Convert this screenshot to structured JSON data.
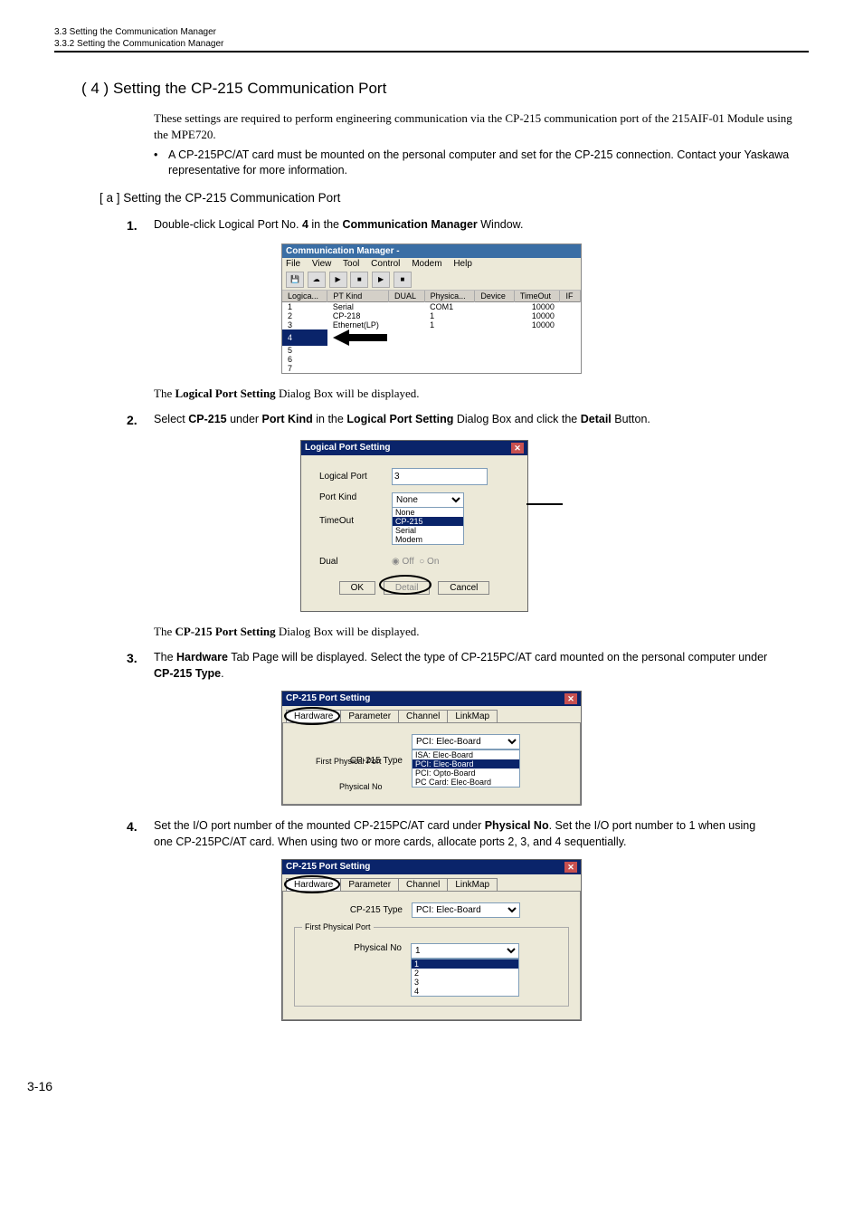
{
  "header": {
    "top": "3.3  Setting the Communication Manager",
    "sub": "3.3.2  Setting the Communication Manager"
  },
  "section4": {
    "title": "( 4 )   Setting the CP-215 Communication Port",
    "intro": "These settings are required to perform engineering communication via the CP-215 communication port of the 215AIF-01 Module using the MPE720.",
    "bullet": "A CP-215PC/AT card must be mounted on the personal computer and set for the CP-215 connection. Contact your Yaskawa representative for more information."
  },
  "suba": {
    "title": "[ a ]  Setting the CP-215 Communication Port"
  },
  "step1": {
    "num": "1.",
    "pre": "Double-click Logical Port No. ",
    "bold1": "4",
    "mid": " in the ",
    "bold2": "Communication Manager",
    "post": " Window."
  },
  "fig1": {
    "title": "Communication Manager -",
    "menu": {
      "file": "File",
      "view": "View",
      "tool": "Tool",
      "control": "Control",
      "modem": "Modem",
      "help": "Help"
    },
    "head": {
      "logical": "Logica...",
      "ptkind": "PT Kind",
      "dual": "DUAL",
      "physical": "Physica...",
      "device": "Device",
      "timeout": "TimeOut",
      "ir": "IF"
    },
    "rows": [
      {
        "n": "1",
        "kind": "Serial",
        "dual": "",
        "phy": "COM1",
        "dev": "",
        "to": "10000"
      },
      {
        "n": "2",
        "kind": "CP-218",
        "dual": "",
        "phy": "1",
        "dev": "",
        "to": "10000"
      },
      {
        "n": "3",
        "kind": "Ethernet(LP)",
        "dual": "",
        "phy": "1",
        "dev": "",
        "to": "10000"
      }
    ],
    "hl": "4",
    "extra": [
      "5",
      "6",
      "7"
    ]
  },
  "note1": {
    "pre": "The ",
    "b": "Logical Port Setting",
    "post": " Dialog Box will be displayed."
  },
  "step2": {
    "num": "2.",
    "t1": "Select ",
    "b1": "CP-215",
    "t2": " under ",
    "b2": "Port Kind",
    "t3": " in the ",
    "b3": "Logical Port Setting",
    "t4": " Dialog Box and click the ",
    "b4": "Detail",
    "t5": " Button."
  },
  "fig2": {
    "title": "Logical Port Setting",
    "logicalport_l": "Logical Port",
    "logicalport_v": "3",
    "portkind_l": "Port Kind",
    "portkind_v": "None",
    "list": [
      "None",
      "CP-215",
      "Serial",
      "Modem"
    ],
    "timeout_l": "TimeOut",
    "dual_l": "Dual",
    "dual_off": "Off",
    "dual_on": "On",
    "ok": "OK",
    "detail": "Detail",
    "cancel": "Cancel"
  },
  "note2": {
    "pre": "The ",
    "b": "CP-215 Port Setting",
    "post": " Dialog Box will be displayed."
  },
  "step3": {
    "num": "3.",
    "t1": "The ",
    "b1": "Hardware",
    "t2": " Tab Page will be displayed. Select the type of CP-215PC/AT card mounted on the personal computer under ",
    "b2": "CP-215 Type",
    "t3": "."
  },
  "fig3": {
    "title": "CP-215 Port Setting",
    "tabs": {
      "hw": "Hardware",
      "pa": "Parameter",
      "ch": "Channel",
      "lm": "LinkMap"
    },
    "typ_l": "CP-215 Type",
    "typ_v": "PCI: Elec-Board",
    "list": [
      "ISA: Elec-Board",
      "PCI: Elec-Board",
      "PCI: Opto-Board",
      "PC Card: Elec-Board"
    ],
    "fpp_l": "First Physical Port",
    "pn_l": "Physical No"
  },
  "step4": {
    "num": "4.",
    "t1": "Set the I/O port number of the mounted CP-215PC/AT card under ",
    "b1": "Physical No",
    "t2": ". Set the I/O port number to 1 when using one CP-215PC/AT card. When using two or more cards, allocate ports 2, 3, and 4 sequentially."
  },
  "fig4": {
    "title": "CP-215 Port Setting",
    "tabs": {
      "hw": "Hardware",
      "pa": "Parameter",
      "ch": "Channel",
      "lm": "LinkMap"
    },
    "typ_l": "CP-215 Type",
    "typ_v": "PCI: Elec-Board",
    "fpp_l": "First Physical Port",
    "pn_l": "Physical No",
    "pn_v": "1",
    "list": [
      "1",
      "2",
      "3",
      "4"
    ]
  },
  "footer": {
    "page": "3-16"
  }
}
